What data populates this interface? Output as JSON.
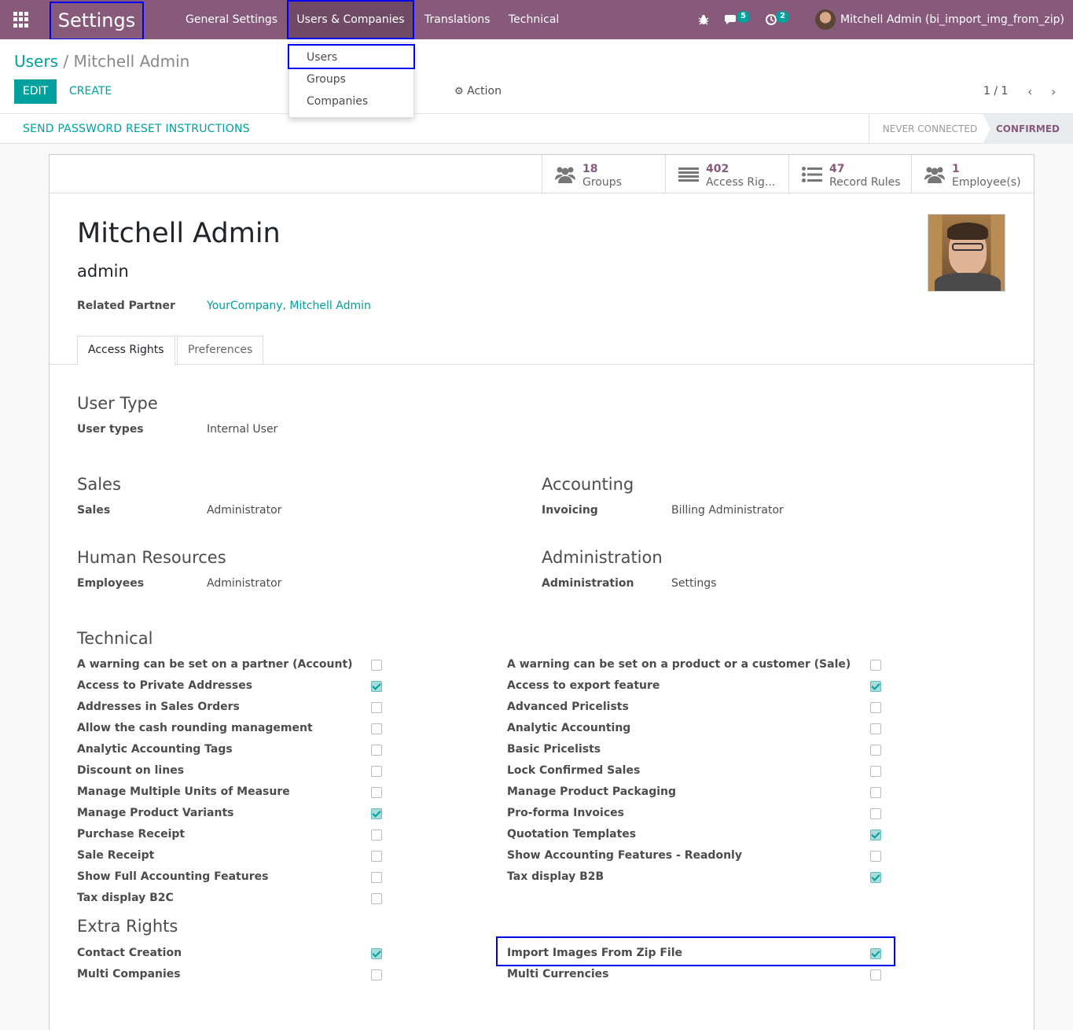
{
  "nav": {
    "brand": "Settings",
    "menus": [
      "General Settings",
      "Users & Companies",
      "Translations",
      "Technical"
    ],
    "messages_count": "5",
    "activities_count": "2",
    "user": "Mitchell Admin (bi_import_img_from_zip)"
  },
  "dropdown": {
    "items": [
      "Users",
      "Groups",
      "Companies"
    ]
  },
  "breadcrumb": {
    "parent": "Users",
    "sep": "/",
    "current": "Mitchell Admin"
  },
  "buttons": {
    "edit": "EDIT",
    "create": "CREATE",
    "action": "Action"
  },
  "pager": {
    "text": "1 / 1"
  },
  "statusbar": {
    "send_pw": "SEND PASSWORD RESET INSTRUCTIONS",
    "never": "NEVER CONNECTED",
    "confirmed": "CONFIRMED"
  },
  "stats": [
    {
      "n": "18",
      "label": "Groups"
    },
    {
      "n": "402",
      "label": "Access Rig..."
    },
    {
      "n": "47",
      "label": "Record Rules"
    },
    {
      "n": "1",
      "label": "Employee(s)"
    }
  ],
  "user": {
    "name": "Mitchell Admin",
    "login": "admin",
    "partner_label": "Related Partner",
    "partner": "YourCompany, Mitchell Admin"
  },
  "tabs": [
    "Access Rights",
    "Preferences"
  ],
  "user_type": {
    "title": "User Type",
    "label": "User types",
    "value": "Internal User"
  },
  "sales": {
    "title": "Sales",
    "label": "Sales",
    "value": "Administrator"
  },
  "accounting": {
    "title": "Accounting",
    "label": "Invoicing",
    "value": "Billing Administrator"
  },
  "hr": {
    "title": "Human Resources",
    "label": "Employees",
    "value": "Administrator"
  },
  "admin": {
    "title": "Administration",
    "label": "Administration",
    "value": "Settings"
  },
  "technical": {
    "title": "Technical",
    "left": [
      {
        "label": "A warning can be set on a partner (Account)",
        "checked": false
      },
      {
        "label": "Access to Private Addresses",
        "checked": true
      },
      {
        "label": "Addresses in Sales Orders",
        "checked": false
      },
      {
        "label": "Allow the cash rounding management",
        "checked": false
      },
      {
        "label": "Analytic Accounting Tags",
        "checked": false
      },
      {
        "label": "Discount on lines",
        "checked": false
      },
      {
        "label": "Manage Multiple Units of Measure",
        "checked": false
      },
      {
        "label": "Manage Product Variants",
        "checked": true
      },
      {
        "label": "Purchase Receipt",
        "checked": false
      },
      {
        "label": "Sale Receipt",
        "checked": false
      },
      {
        "label": "Show Full Accounting Features",
        "checked": false
      },
      {
        "label": "Tax display B2C",
        "checked": false
      }
    ],
    "right": [
      {
        "label": "A warning can be set on a product or a customer (Sale)",
        "checked": false
      },
      {
        "label": "Access to export feature",
        "checked": true
      },
      {
        "label": "Advanced Pricelists",
        "checked": false
      },
      {
        "label": "Analytic Accounting",
        "checked": false
      },
      {
        "label": "Basic Pricelists",
        "checked": false
      },
      {
        "label": "Lock Confirmed Sales",
        "checked": false
      },
      {
        "label": "Manage Product Packaging",
        "checked": false
      },
      {
        "label": "Pro-forma Invoices",
        "checked": false
      },
      {
        "label": "Quotation Templates",
        "checked": true
      },
      {
        "label": "Show Accounting Features - Readonly",
        "checked": false
      },
      {
        "label": "Tax display B2B",
        "checked": true
      }
    ]
  },
  "extra": {
    "title": "Extra Rights",
    "left": [
      {
        "label": "Contact Creation",
        "checked": true
      },
      {
        "label": "Multi Companies",
        "checked": false
      }
    ],
    "right": [
      {
        "label": "Import Images From Zip File",
        "checked": true
      },
      {
        "label": "Multi Currencies",
        "checked": false
      }
    ]
  },
  "colors": {
    "brand": "#875a7b",
    "accent": "#00a09d",
    "highlight": "#0000ee"
  }
}
